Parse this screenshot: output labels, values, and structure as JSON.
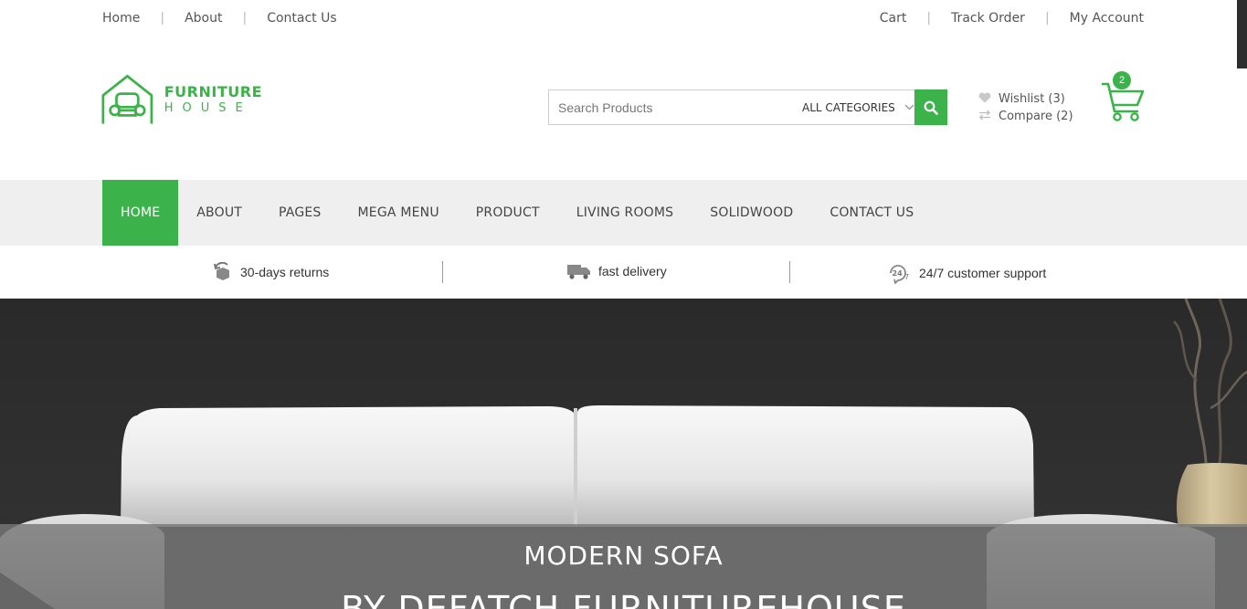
{
  "topbar": {
    "left_links": [
      "Home",
      "About",
      "Contact Us"
    ],
    "right_links": [
      "Cart",
      "Track Order",
      "My Account"
    ]
  },
  "logo": {
    "line1": "FURNITURE",
    "line2": "HOUSE",
    "brand_color": "#3cb34a"
  },
  "search": {
    "placeholder": "Search Products",
    "category": "ALL CATEGORIES"
  },
  "wishlist": {
    "label": "Wishlist (3)"
  },
  "compare": {
    "label": "Compare (2)"
  },
  "cart": {
    "count": "2"
  },
  "nav": {
    "items": [
      "HOME",
      "ABOUT",
      "PAGES",
      "MEGA MENU",
      "PRODUCT",
      "LIVING ROOMS",
      "SOLIDWOOD",
      "CONTACT US"
    ],
    "active": "HOME"
  },
  "features": [
    {
      "icon": "returns-icon",
      "label": "30-days returns"
    },
    {
      "icon": "delivery-truck-icon",
      "label": "fast delivery"
    },
    {
      "icon": "support-24-7-icon",
      "label": "24/7 customer support"
    }
  ],
  "hero": {
    "title": "MODERN SOFA",
    "subtitle": "BY DEFATCH FURNITUREHOUSE"
  }
}
